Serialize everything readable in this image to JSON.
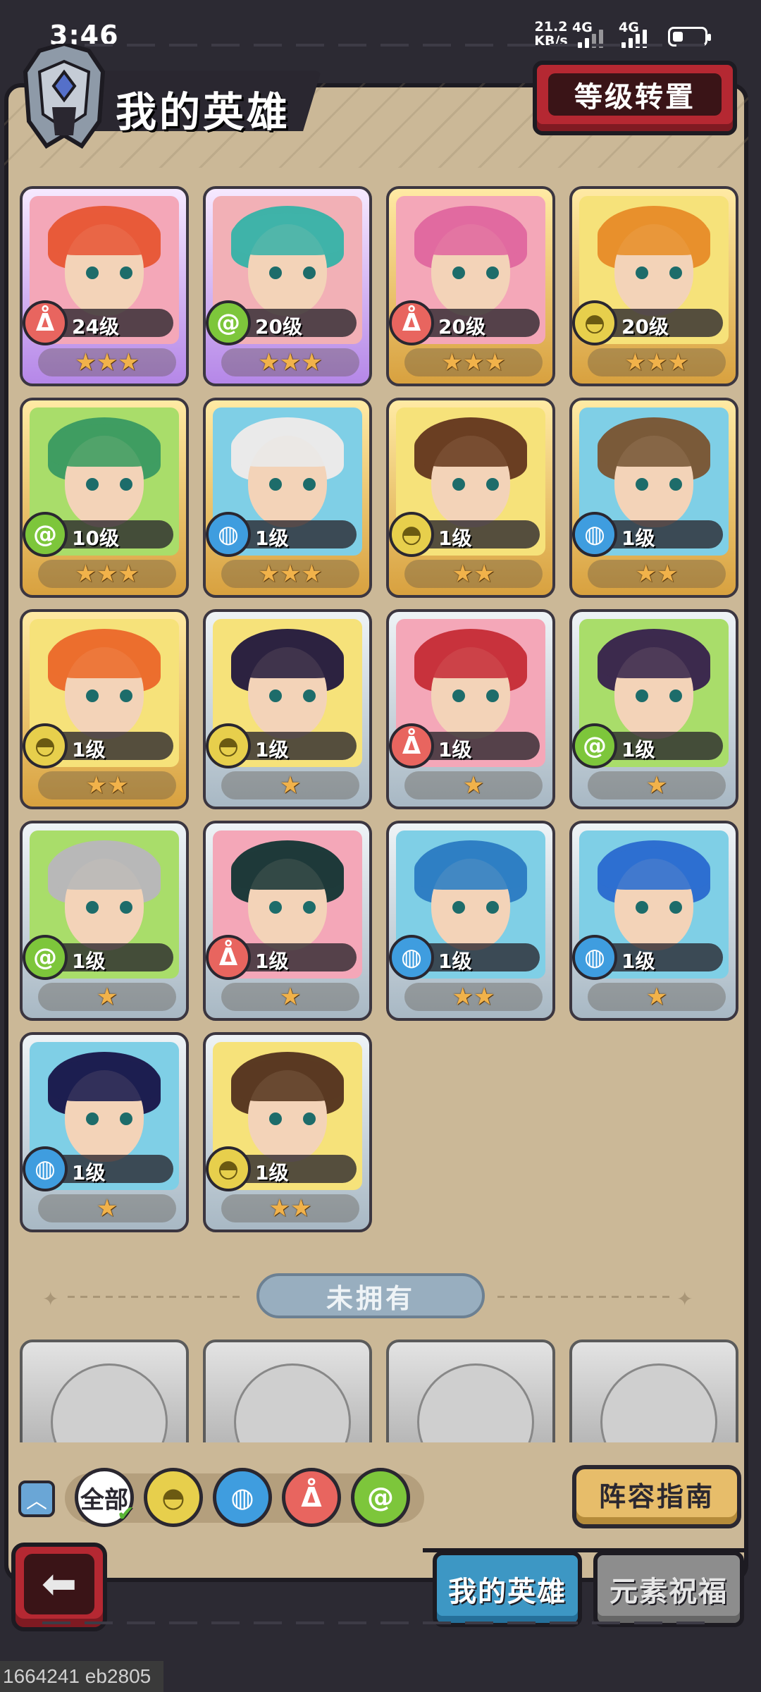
{
  "status_bar": {
    "time": "3:46",
    "net_speed_value": "21.2",
    "net_speed_unit": "KB/s",
    "signal1_label": "4G",
    "signal2_label": "4G"
  },
  "header": {
    "title": "我的英雄",
    "level_transfer_label": "等级转置"
  },
  "heroes": [
    {
      "level": "24级",
      "element": "fire",
      "stars": "★★★",
      "rarity": "purple",
      "hair": "#e85a3a",
      "bg": "#f4a7b8"
    },
    {
      "level": "20级",
      "element": "wood",
      "stars": "★★★",
      "rarity": "purple",
      "hair": "#3fb2a8",
      "bg": "#f2b0b6"
    },
    {
      "level": "20级",
      "element": "fire",
      "stars": "★★★",
      "rarity": "gold",
      "hair": "#e16aa0",
      "bg": "#f4a7b8"
    },
    {
      "level": "20级",
      "element": "earth",
      "stars": "★★★",
      "rarity": "gold",
      "hair": "#e8902c",
      "bg": "#f6e27a"
    },
    {
      "level": "10级",
      "element": "wood",
      "stars": "★★★",
      "rarity": "gold",
      "hair": "#3f9d62",
      "bg": "#a9dd6a"
    },
    {
      "level": "1级",
      "element": "water",
      "stars": "★★★",
      "rarity": "gold",
      "hair": "#eaeaea",
      "bg": "#7fcfe6"
    },
    {
      "level": "1级",
      "element": "earth",
      "stars": "★★",
      "rarity": "gold",
      "hair": "#6a3e22",
      "bg": "#f6e27a"
    },
    {
      "level": "1级",
      "element": "water",
      "stars": "★★",
      "rarity": "gold",
      "hair": "#7a5a3a",
      "bg": "#7fcfe6"
    },
    {
      "level": "1级",
      "element": "earth",
      "stars": "★★",
      "rarity": "gold",
      "hair": "#ec6e2e",
      "bg": "#f6e27a"
    },
    {
      "level": "1级",
      "element": "earth",
      "stars": "★",
      "rarity": "silver",
      "hair": "#2c2240",
      "bg": "#f6e27a"
    },
    {
      "level": "1级",
      "element": "fire",
      "stars": "★",
      "rarity": "silver",
      "hair": "#c8323c",
      "bg": "#f4a7b8"
    },
    {
      "level": "1级",
      "element": "wood",
      "stars": "★",
      "rarity": "silver",
      "hair": "#3c2a4e",
      "bg": "#a9dd6a"
    },
    {
      "level": "1级",
      "element": "wood",
      "stars": "★",
      "rarity": "silver",
      "hair": "#b8b8b8",
      "bg": "#a9dd6a"
    },
    {
      "level": "1级",
      "element": "fire",
      "stars": "★",
      "rarity": "silver",
      "hair": "#1e3a3a",
      "bg": "#f4a7b8"
    },
    {
      "level": "1级",
      "element": "water",
      "stars": "★★",
      "rarity": "silver",
      "hair": "#2f7fc4",
      "bg": "#7fcfe6"
    },
    {
      "level": "1级",
      "element": "water",
      "stars": "★",
      "rarity": "silver",
      "hair": "#2e6fd0",
      "bg": "#7fcfe6"
    },
    {
      "level": "1级",
      "element": "water",
      "stars": "★",
      "rarity": "silver",
      "hair": "#1d1e50",
      "bg": "#7fcfe6"
    },
    {
      "level": "1级",
      "element": "earth",
      "stars": "★★",
      "rarity": "silver",
      "hair": "#5a3a22",
      "bg": "#f6e27a"
    }
  ],
  "element_glyphs": {
    "fire": "ᐂ",
    "wood": "@",
    "earth": "◓",
    "water": "◍"
  },
  "unowned_label": "未拥有",
  "filters": {
    "all_label": "全部"
  },
  "lineup_guide_label": "阵容指南",
  "tabs": {
    "my_heroes": "我的英雄",
    "element_blessing": "元素祝福"
  },
  "build_id": "1664241 eb2805"
}
